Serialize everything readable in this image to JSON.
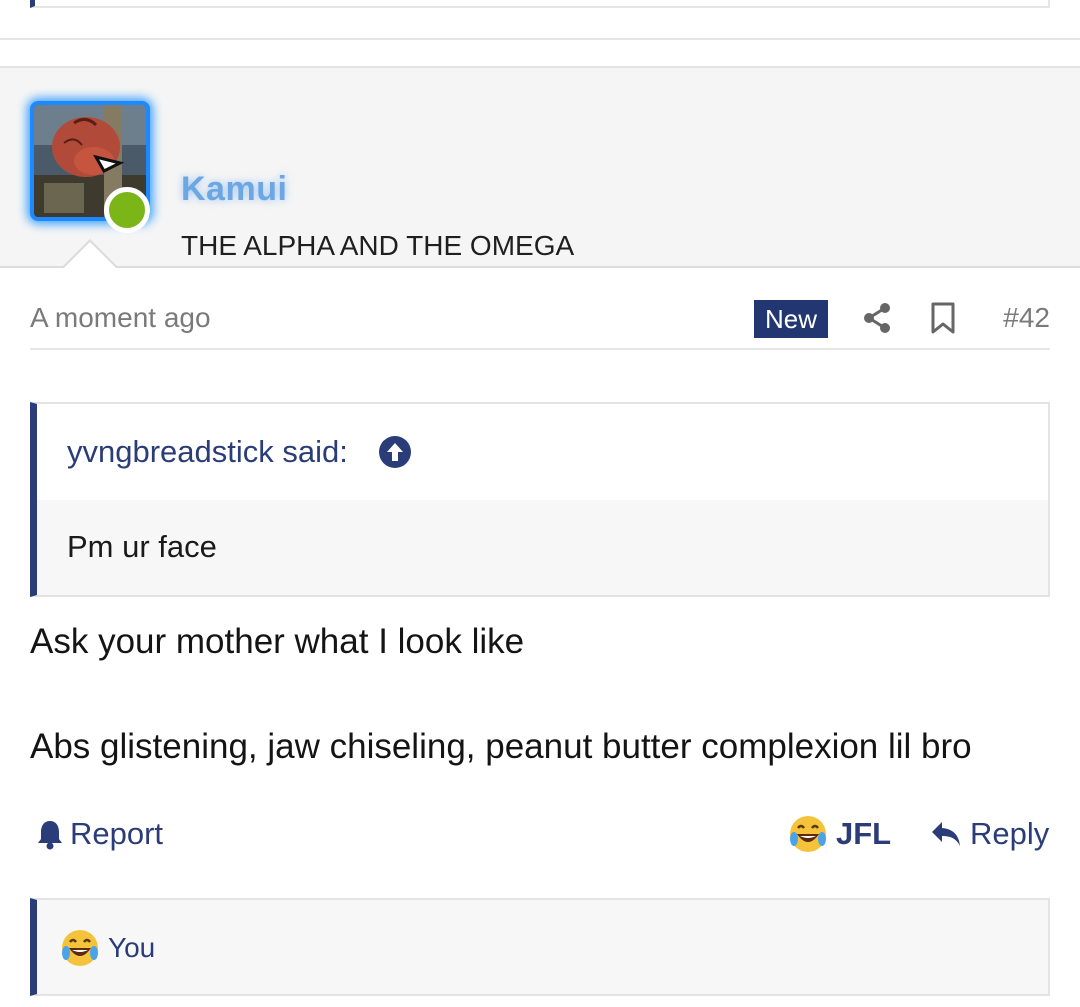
{
  "post": {
    "user": {
      "name": "Kamui",
      "title": "THE ALPHA AND THE OMEGA",
      "status": "online"
    },
    "meta": {
      "timestamp": "A moment ago",
      "badge": "New",
      "post_number": "#42"
    },
    "quote": {
      "author": "yvngbreadstick said:",
      "text": "Pm ur face"
    },
    "message": {
      "line1": "Ask your mother what I look like",
      "line2": "Abs glistening, jaw chiseling, peanut butter complexion lil bro"
    },
    "actions": {
      "report": "Report",
      "reaction_label": "JFL",
      "reply": "Reply"
    },
    "reactions": {
      "by": "You"
    }
  },
  "icons": [
    "share-icon",
    "bookmark-icon",
    "arrow-up-circle-icon",
    "bell-icon",
    "laugh-cry-emoji-icon",
    "reply-arrow-icon"
  ],
  "colors": {
    "accent": "#2b3d78",
    "badge_bg": "#223671",
    "online": "#7cb518",
    "username": "#6aa7e3"
  }
}
